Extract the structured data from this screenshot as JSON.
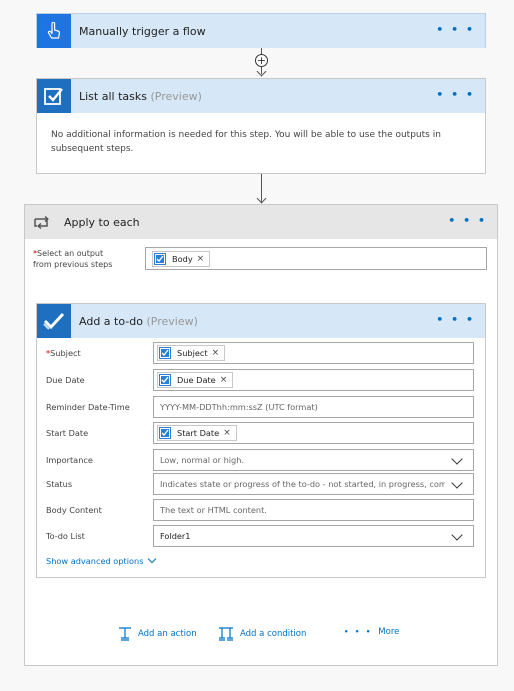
{
  "trigger": {
    "title": "Manually trigger a flow"
  },
  "list_tasks": {
    "title": "List all tasks",
    "preview": "(Preview)",
    "info": "No additional information is needed for this step. You will be able to use the outputs in subsequent steps."
  },
  "apply_each": {
    "title": "Apply to each",
    "select_label_1": "Select an output",
    "select_label_2": "from previous steps",
    "select_token": "Body"
  },
  "todo": {
    "title": "Add a to-do",
    "preview": "(Preview)",
    "fields": {
      "subject": {
        "label": "Subject",
        "token": "Subject"
      },
      "due_date": {
        "label": "Due Date",
        "token": "Due Date"
      },
      "reminder": {
        "label": "Reminder Date-Time",
        "placeholder": "YYYY-MM-DDThh:mm:ssZ (UTC format)"
      },
      "start_date": {
        "label": "Start Date",
        "token": "Start Date"
      },
      "importance": {
        "label": "Importance",
        "placeholder": "Low, normal or high."
      },
      "status": {
        "label": "Status",
        "placeholder": "Indicates state or progress of the to-do - not started, in progress, comp"
      },
      "body": {
        "label": "Body Content",
        "placeholder": "The text or HTML content."
      },
      "todo_list": {
        "label": "To-do List",
        "value": "Folder1"
      }
    },
    "advanced": "Show advanced options"
  },
  "footer": {
    "add_action": "Add an action",
    "add_condition": "Add a condition",
    "more": "More"
  },
  "more_dots": "• • •",
  "colors": {
    "accent": "#0072c6",
    "trigger_icon": "#1e74e0",
    "header_blue": "#d6e7f7",
    "header_grey": "#e6e6e6"
  }
}
